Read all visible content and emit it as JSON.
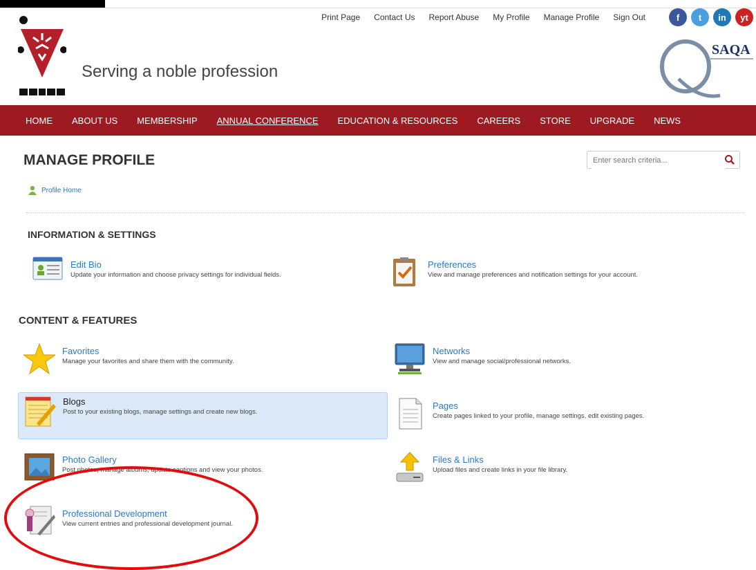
{
  "top_links": [
    "Print Page",
    "Contact Us",
    "Report Abuse",
    "My Profile",
    "Manage Profile",
    "Sign Out"
  ],
  "socials": [
    {
      "label": "f",
      "color": "#3b5998"
    },
    {
      "label": "t",
      "color": "#4a9fe0"
    },
    {
      "label": "in",
      "color": "#1e79b5"
    },
    {
      "label": "yt",
      "color": "#cc2222"
    }
  ],
  "logo": {
    "letters": "SAIOH"
  },
  "tagline": "Serving a noble profession",
  "saqa_logo_text": "SAQA",
  "nav": [
    "HOME",
    "ABOUT US",
    "MEMBERSHIP",
    "ANNUAL CONFERENCE",
    "EDUCATION & RESOURCES",
    "CAREERS",
    "STORE",
    "UPGRADE",
    "NEWS"
  ],
  "page_title": "MANAGE PROFILE",
  "search": {
    "placeholder": "Enter search criteria..."
  },
  "profile_home": "Profile Home",
  "section_info": "INFORMATION & SETTINGS",
  "section_content": "CONTENT & FEATURES",
  "cards": {
    "edit_bio": {
      "title": "Edit Bio",
      "desc": "Update your information and choose privacy settings for individual fields."
    },
    "preferences": {
      "title": "Preferences",
      "desc": "View and manage preferences and notification settings for your account."
    },
    "favorites": {
      "title": "Favorites",
      "desc": "Manage your favorites and share them with the community."
    },
    "networks": {
      "title": "Networks",
      "desc": "View and manage social/professional networks."
    },
    "blogs": {
      "title": "Blogs",
      "desc": "Post to your existing blogs, manage settings and create new blogs."
    },
    "pages": {
      "title": "Pages",
      "desc": "Create pages linked to your profile, manage settings, edit existing pages."
    },
    "photo_gallery": {
      "title": "Photo Gallery",
      "desc": "Post photos, manage albums, update captions and view your photos."
    },
    "files_links": {
      "title": "Files & Links",
      "desc": "Upload files and create links in your file library."
    },
    "professional_development": {
      "title": "Professional Development",
      "desc": "View current entries and professional development journal."
    }
  },
  "colors": {
    "nav_bg": "#9e1a22",
    "link": "#2a7ac4",
    "highlight": "#dbe9f8",
    "annotation": "#e30b0b"
  }
}
